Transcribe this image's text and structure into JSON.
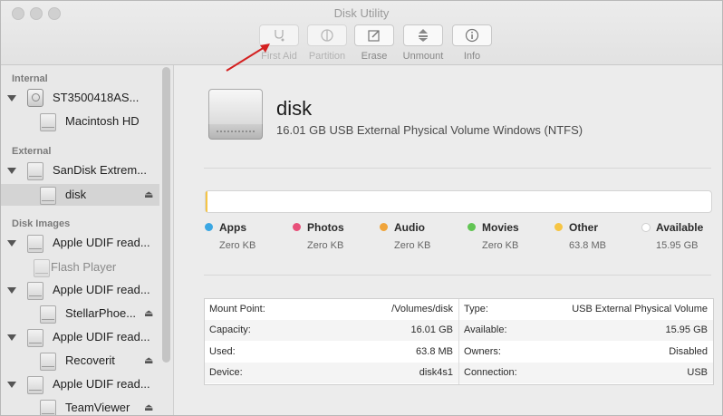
{
  "window": {
    "title": "Disk Utility"
  },
  "toolbar": {
    "buttons": [
      {
        "label": "First Aid",
        "icon": "stethoscope-icon"
      },
      {
        "label": "Partition",
        "icon": "partition-pie-icon"
      },
      {
        "label": "Erase",
        "icon": "erase-pencil-icon"
      },
      {
        "label": "Unmount",
        "icon": "unmount-icon"
      },
      {
        "label": "Info",
        "icon": "info-icon"
      }
    ]
  },
  "sidebar": {
    "sections": [
      "Internal",
      "External",
      "Disk Images"
    ],
    "items": [
      {
        "label": "ST3500418AS..."
      },
      {
        "label": "Macintosh HD"
      },
      {
        "label": "SanDisk Extrem..."
      },
      {
        "label": "disk"
      },
      {
        "label": "Apple UDIF read..."
      },
      {
        "label": "Flash Player"
      },
      {
        "label": "Apple UDIF read..."
      },
      {
        "label": "StellarPhoe..."
      },
      {
        "label": "Apple UDIF read..."
      },
      {
        "label": "Recoverit"
      },
      {
        "label": "Apple UDIF read..."
      },
      {
        "label": "TeamViewer"
      }
    ]
  },
  "disk": {
    "name": "disk",
    "subtitle": "16.01 GB USB External Physical Volume Windows (NTFS)",
    "used_fraction": 0.004
  },
  "legend": [
    {
      "name": "Apps",
      "value": "Zero KB",
      "color": "#3ba7e3"
    },
    {
      "name": "Photos",
      "value": "Zero KB",
      "color": "#e8507a"
    },
    {
      "name": "Audio",
      "value": "Zero KB",
      "color": "#f0a43a"
    },
    {
      "name": "Movies",
      "value": "Zero KB",
      "color": "#62c554"
    },
    {
      "name": "Other",
      "value": "63.8 MB",
      "color": "#f6c544"
    },
    {
      "name": "Available",
      "value": "15.95 GB",
      "color": "#ffffff"
    }
  ],
  "info": {
    "left": [
      {
        "key": "Mount Point:",
        "value": "/Volumes/disk"
      },
      {
        "key": "Capacity:",
        "value": "16.01 GB"
      },
      {
        "key": "Used:",
        "value": "63.8 MB"
      },
      {
        "key": "Device:",
        "value": "disk4s1"
      }
    ],
    "right": [
      {
        "key": "Type:",
        "value": "USB External Physical Volume"
      },
      {
        "key": "Available:",
        "value": "15.95 GB"
      },
      {
        "key": "Owners:",
        "value": "Disabled"
      },
      {
        "key": "Connection:",
        "value": "USB"
      }
    ]
  },
  "colors": {
    "annotation_arrow": "#d42020",
    "other_fill": "#f6c544"
  }
}
